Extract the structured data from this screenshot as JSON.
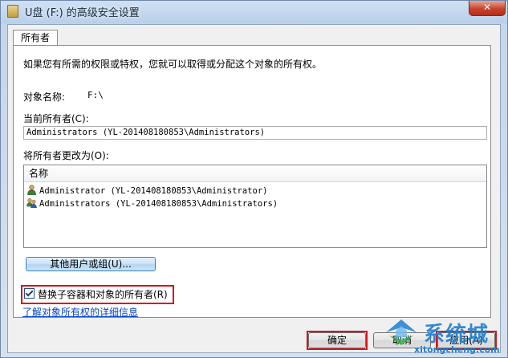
{
  "window": {
    "title": "U盘 (F:) 的高级安全设置",
    "close_label": "✕"
  },
  "tabs": [
    {
      "label": "所有者"
    }
  ],
  "panel": {
    "intro": "如果您有所需的权限或特权，您就可以取得或分配这个对象的所有权。",
    "object_name_label": "对象名称:",
    "object_name_value": "F:\\",
    "current_owner_label": "当前所有者(C):",
    "current_owner_value": "Administrators (YL-201408180853\\Administrators)",
    "change_owner_label": "将所有者更改为(O):",
    "list": {
      "column_name": "名称",
      "items": [
        {
          "label": "Administrator (YL-201408180853\\Administrator)",
          "icon": "user-icon"
        },
        {
          "label": "Administrators (YL-201408180853\\Administrators)",
          "icon": "group-icon"
        }
      ]
    },
    "other_users_button": "其他用户或组(U)...",
    "replace_owner_checkbox": "替换子容器和对象的所有者(R)",
    "replace_owner_checked": true,
    "learn_more_link": "了解对象所有权的详细信息"
  },
  "footer": {
    "ok_button": "确定",
    "cancel_button": "取消",
    "apply_button": "应用(A)"
  },
  "watermark": {
    "text": "系统城",
    "sub": "xitongcheng.com"
  },
  "colors": {
    "highlight": "#d7141a",
    "link": "#0645c9",
    "watermark": "#1d7fd0"
  }
}
